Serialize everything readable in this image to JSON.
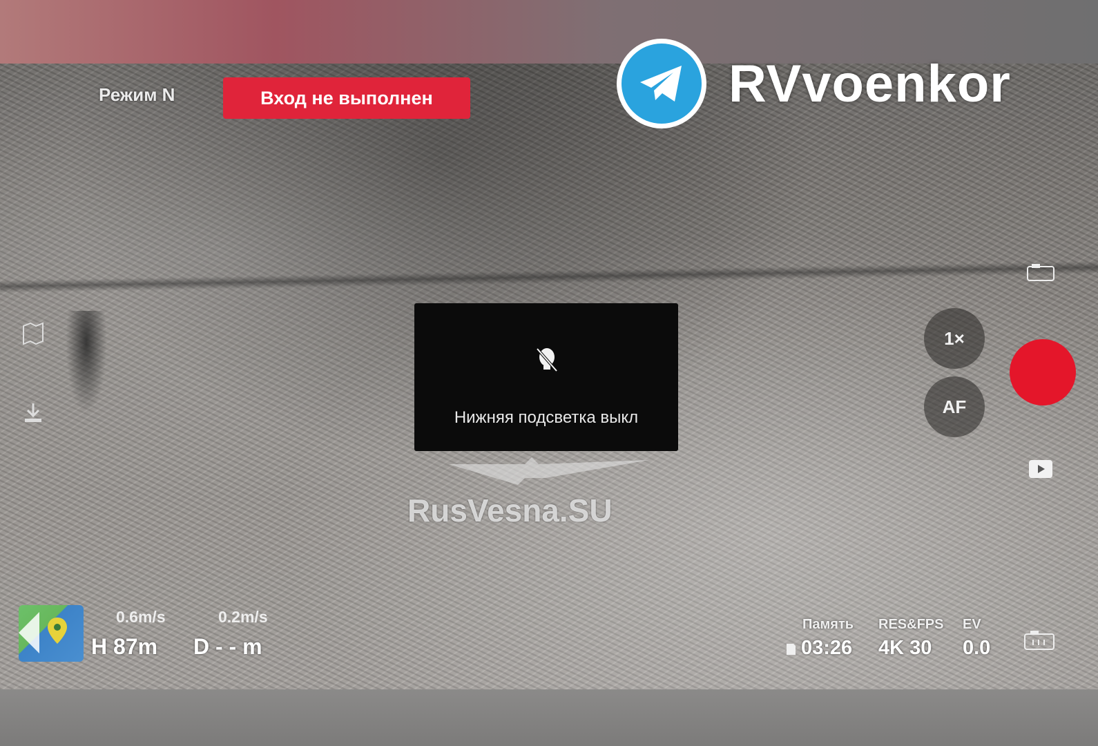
{
  "hud": {
    "mode": "Режим N",
    "login_status": "Вход не выполнен"
  },
  "watermarks": {
    "channel": "RVvoenkor",
    "site": "RusVesna.SU"
  },
  "toast": {
    "icon": "bulb-off-icon",
    "message": "Нижняя подсветка выкл"
  },
  "controls": {
    "zoom": "1×",
    "focus": "AF"
  },
  "telemetry": {
    "vertical_speed": "0.6m/s",
    "horizontal_speed": "0.2m/s",
    "height": "H 87m",
    "distance": "D - - m"
  },
  "camera_info": {
    "memory_label": "Память",
    "memory_value": "03:26",
    "resfps_label": "RES&FPS",
    "resfps_value": "4K 30",
    "ev_label": "EV",
    "ev_value": "0.0"
  },
  "colors": {
    "alert_red": "#e0243a",
    "record_red": "#e4162a",
    "telegram_blue": "#2aa3de"
  }
}
